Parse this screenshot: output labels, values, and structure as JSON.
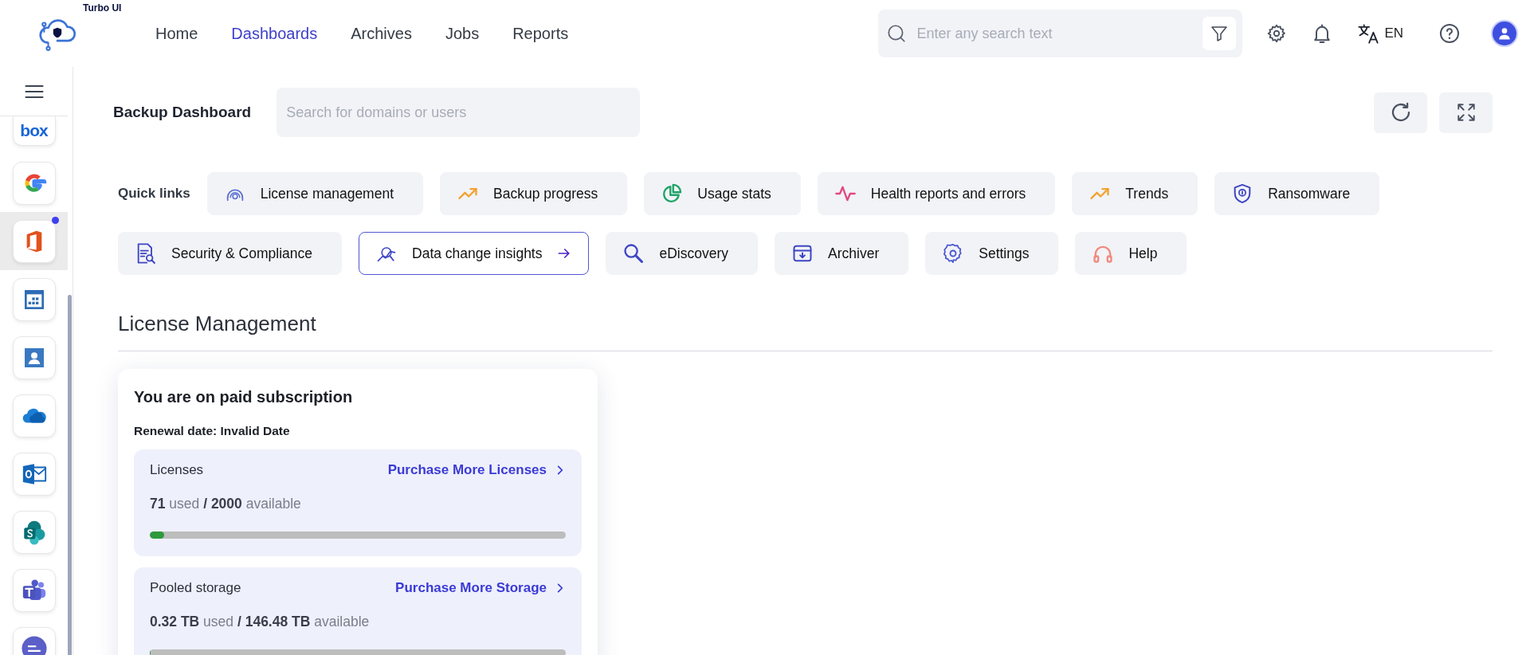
{
  "header": {
    "brand": "Turbo UI",
    "nav": [
      {
        "label": "Home",
        "selected": false
      },
      {
        "label": "Dashboards",
        "selected": true
      },
      {
        "label": "Archives",
        "selected": false
      },
      {
        "label": "Jobs",
        "selected": false
      },
      {
        "label": "Reports",
        "selected": false
      }
    ],
    "search": {
      "placeholder": "Enter any search text"
    },
    "language": "EN"
  },
  "sidebar": {
    "items": [
      {
        "kind": "wordmark",
        "logo_text": "box",
        "selected": false,
        "notified": false
      },
      {
        "kind": "g",
        "selected": false,
        "notified": false
      },
      {
        "kind": "door",
        "selected": true,
        "notified": true
      },
      {
        "kind": "calendar",
        "selected": false,
        "notified": false
      },
      {
        "kind": "contact",
        "selected": false,
        "notified": false
      },
      {
        "kind": "cloud",
        "selected": false,
        "notified": false
      },
      {
        "kind": "envelope",
        "selected": false,
        "notified": false
      },
      {
        "kind": "circles",
        "selected": false,
        "notified": false
      },
      {
        "kind": "people",
        "selected": false,
        "notified": false
      },
      {
        "kind": "chat",
        "selected": false,
        "notified": false
      }
    ]
  },
  "page": {
    "title": "Backup Dashboard",
    "search": {
      "placeholder": "Search for domains or users"
    }
  },
  "quick_links": {
    "label": "Quick links",
    "items": [
      {
        "label": "License management",
        "selected": false
      },
      {
        "label": "Backup progress",
        "selected": false
      },
      {
        "label": "Usage stats",
        "selected": false
      },
      {
        "label": "Health reports and errors",
        "selected": false
      },
      {
        "label": "Trends",
        "selected": false
      },
      {
        "label": "Ransomware",
        "selected": false
      },
      {
        "label": "Security & Compliance",
        "selected": false
      },
      {
        "label": "Data change insights",
        "selected": true
      },
      {
        "label": "eDiscovery",
        "selected": false
      },
      {
        "label": "Archiver",
        "selected": false
      },
      {
        "label": "Settings",
        "selected": false
      },
      {
        "label": "Help",
        "selected": false
      }
    ]
  },
  "section": {
    "title": "License Management"
  },
  "subscription": {
    "title": "You are on paid subscription",
    "renewal": "Renewal date: Invalid Date",
    "meters": [
      {
        "name": "Licenses",
        "link": "Purchase More Licenses",
        "usage": "**71** used **/ 2000** available",
        "level": 0.035
      },
      {
        "name": "Pooled storage",
        "link": "Purchase More Storage",
        "usage": "**0.32 TB** used **/ 146.48 TB** available",
        "level": 0.002
      }
    ]
  }
}
